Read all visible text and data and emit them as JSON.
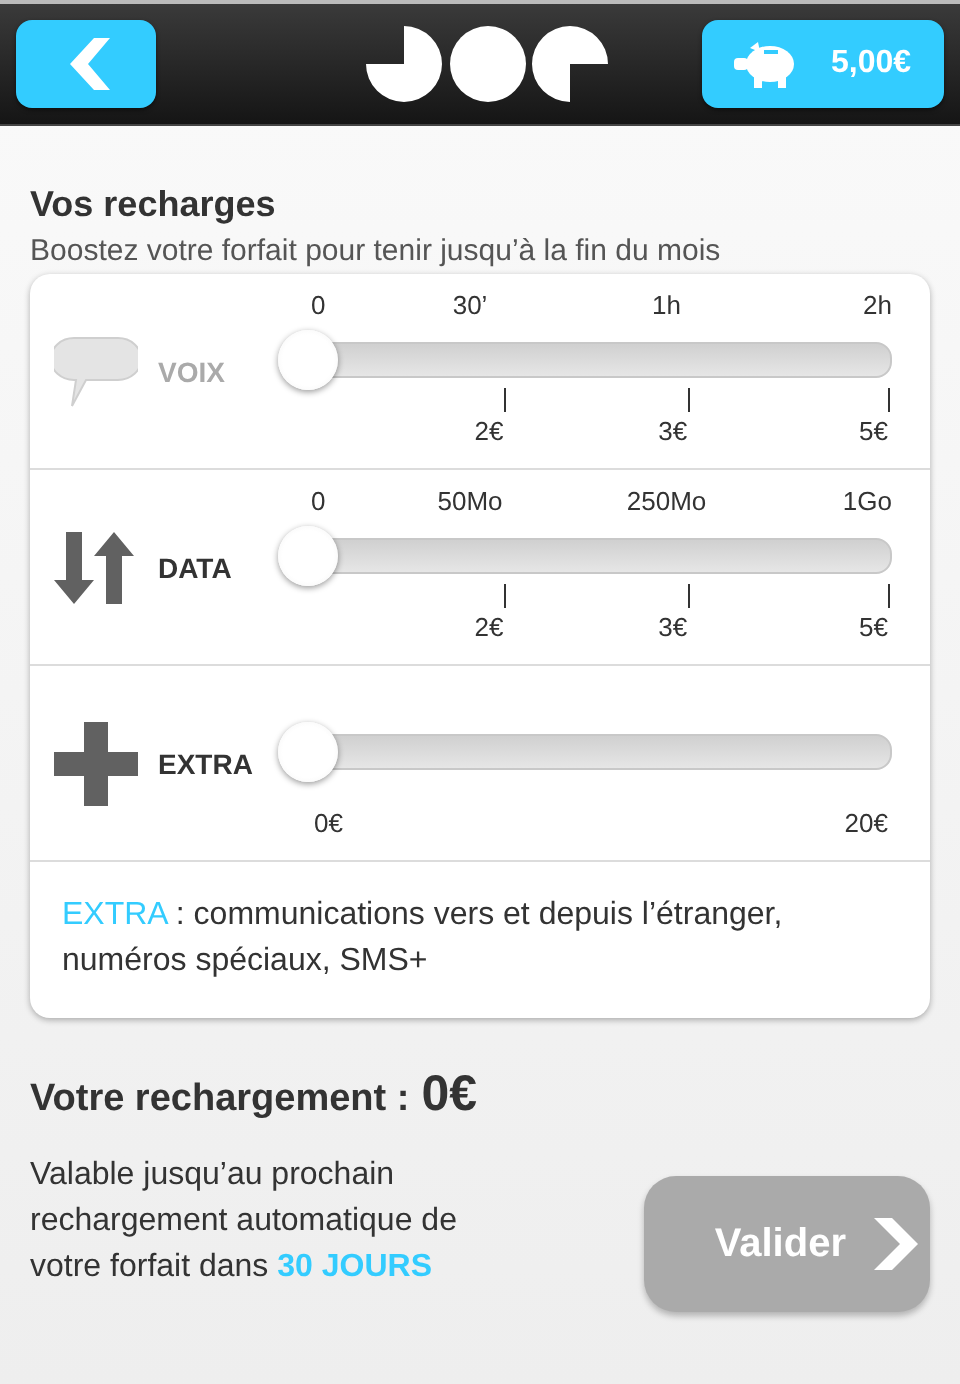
{
  "header": {
    "balance": "5,00€"
  },
  "section": {
    "title": "Vos recharges",
    "subtitle": "Boostez votre forfait pour tenir jusqu’à la fin du mois"
  },
  "sliders": [
    {
      "kind": "voice",
      "name": "VOIX",
      "disabled": true,
      "level": 0,
      "top_labels": [
        "0",
        "30’",
        "1h",
        "2h"
      ],
      "prices": [
        "2€",
        "3€",
        "5€"
      ]
    },
    {
      "kind": "data",
      "name": "DATA",
      "disabled": false,
      "level": 0,
      "top_labels": [
        "0",
        "50Mo",
        "250Mo",
        "1Go"
      ],
      "prices": [
        "2€",
        "3€",
        "5€"
      ]
    },
    {
      "kind": "extra",
      "name": "EXTRA",
      "disabled": false,
      "level": 0,
      "prices": [
        "0€",
        "20€"
      ]
    }
  ],
  "extra_note": {
    "highlight": "EXTRA",
    "text": " : communications vers et depuis l’étranger, numéros spéciaux, SMS+"
  },
  "total": {
    "label": "Votre rechargement :",
    "amount": "0€"
  },
  "validity": {
    "text": "Valable jusqu’au prochain rechargement automatique de votre forfait dans ",
    "highlight": "30 JOURS"
  },
  "validate_button": {
    "label": "Valider",
    "disabled": true
  }
}
